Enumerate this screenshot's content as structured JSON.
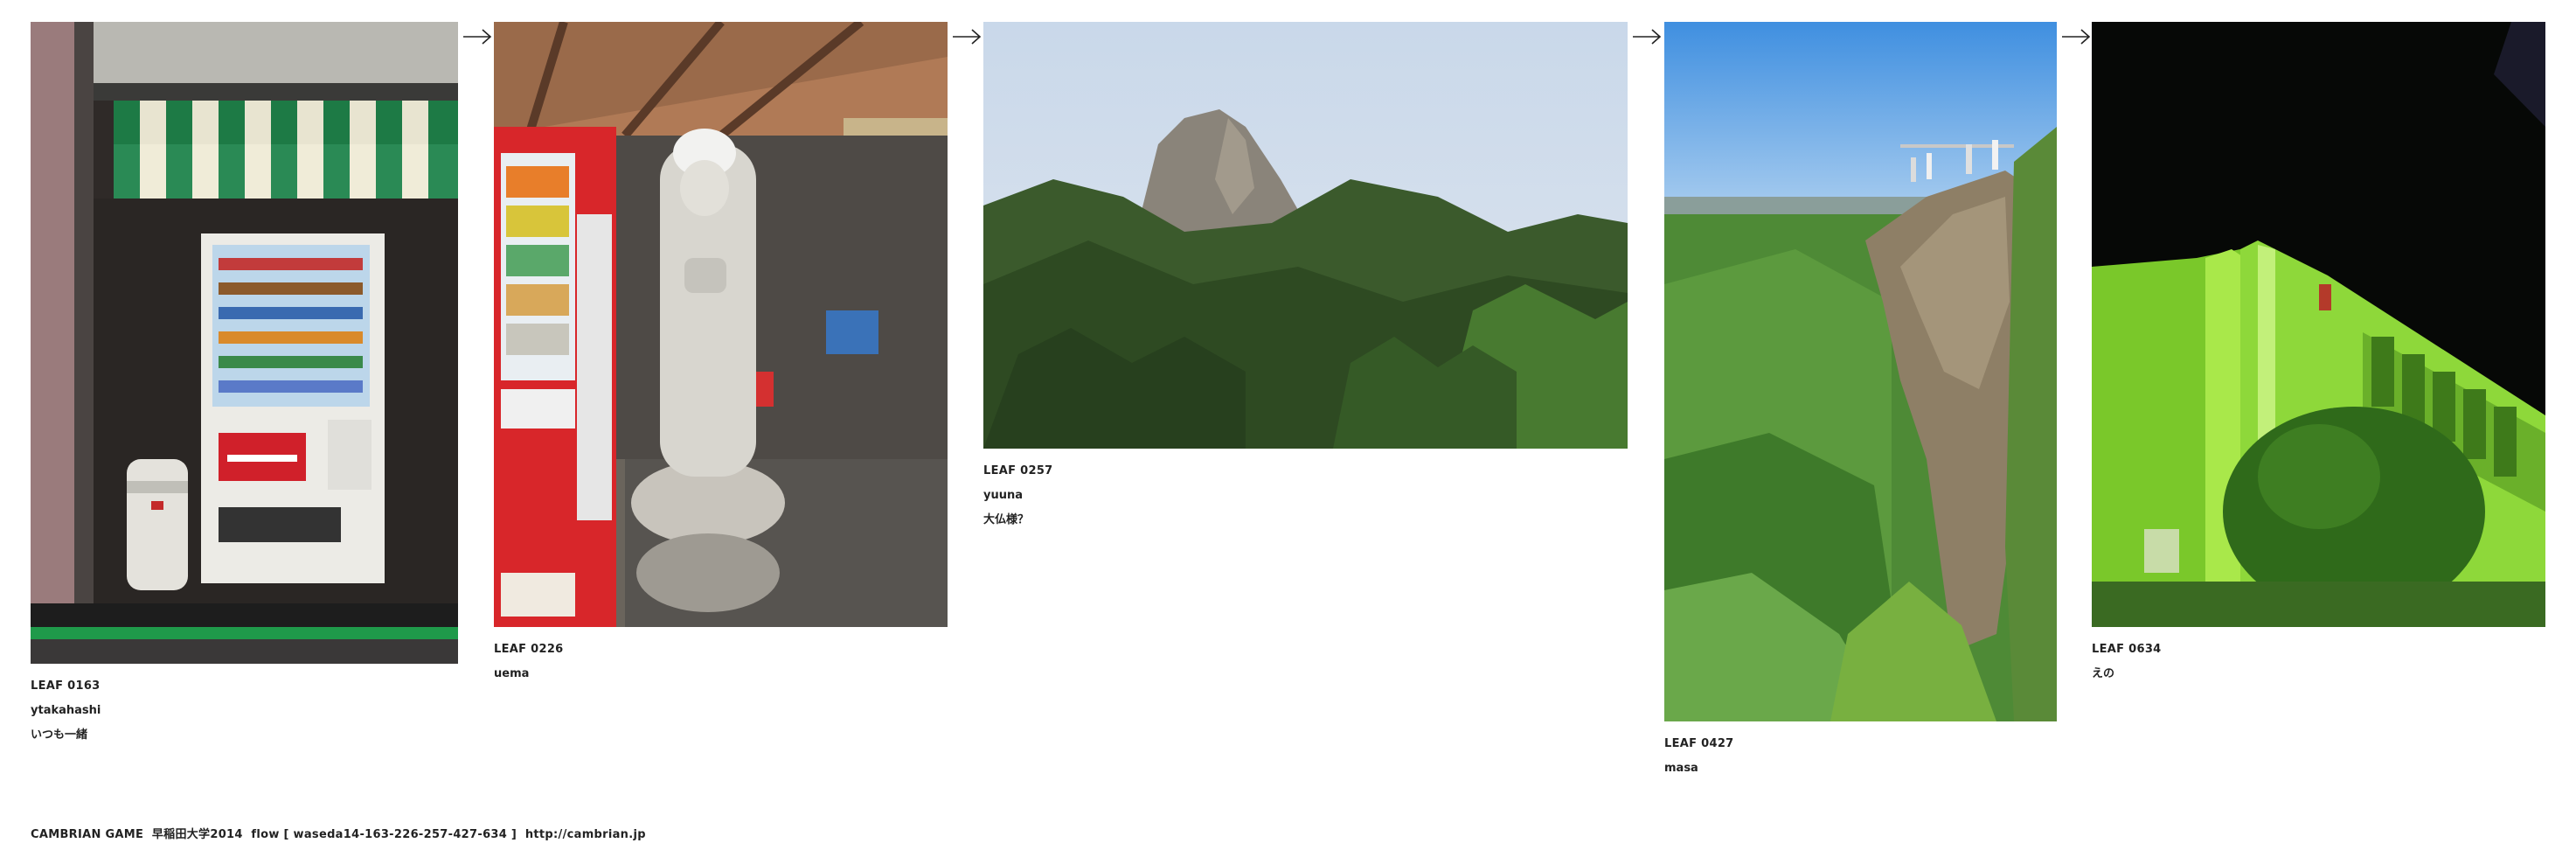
{
  "leaves": [
    {
      "id": "LEAF 0163",
      "user": "ytakahashi",
      "note": "いつも一緒",
      "image_icon": "vending-machine-photo"
    },
    {
      "id": "LEAF 0226",
      "user": "uema",
      "note": "",
      "image_icon": "statue-photo"
    },
    {
      "id": "LEAF 0257",
      "user": "yuuna",
      "note": "大仏様？",
      "image_icon": "rock-mountain-photo"
    },
    {
      "id": "LEAF 0427",
      "user": "masa",
      "note": "",
      "image_icon": "cliff-valley-photo"
    },
    {
      "id": "LEAF 0634",
      "user": "えの",
      "note": "",
      "image_icon": "green-building-night-photo"
    }
  ],
  "arrow_icon": "right-arrow-icon",
  "footer": {
    "text": "CAMBRIAN GAME  早稲田大学2014  flow [ waseda14-163-226-257-427-634 ]  ",
    "link": "http://cambrian.jp"
  }
}
